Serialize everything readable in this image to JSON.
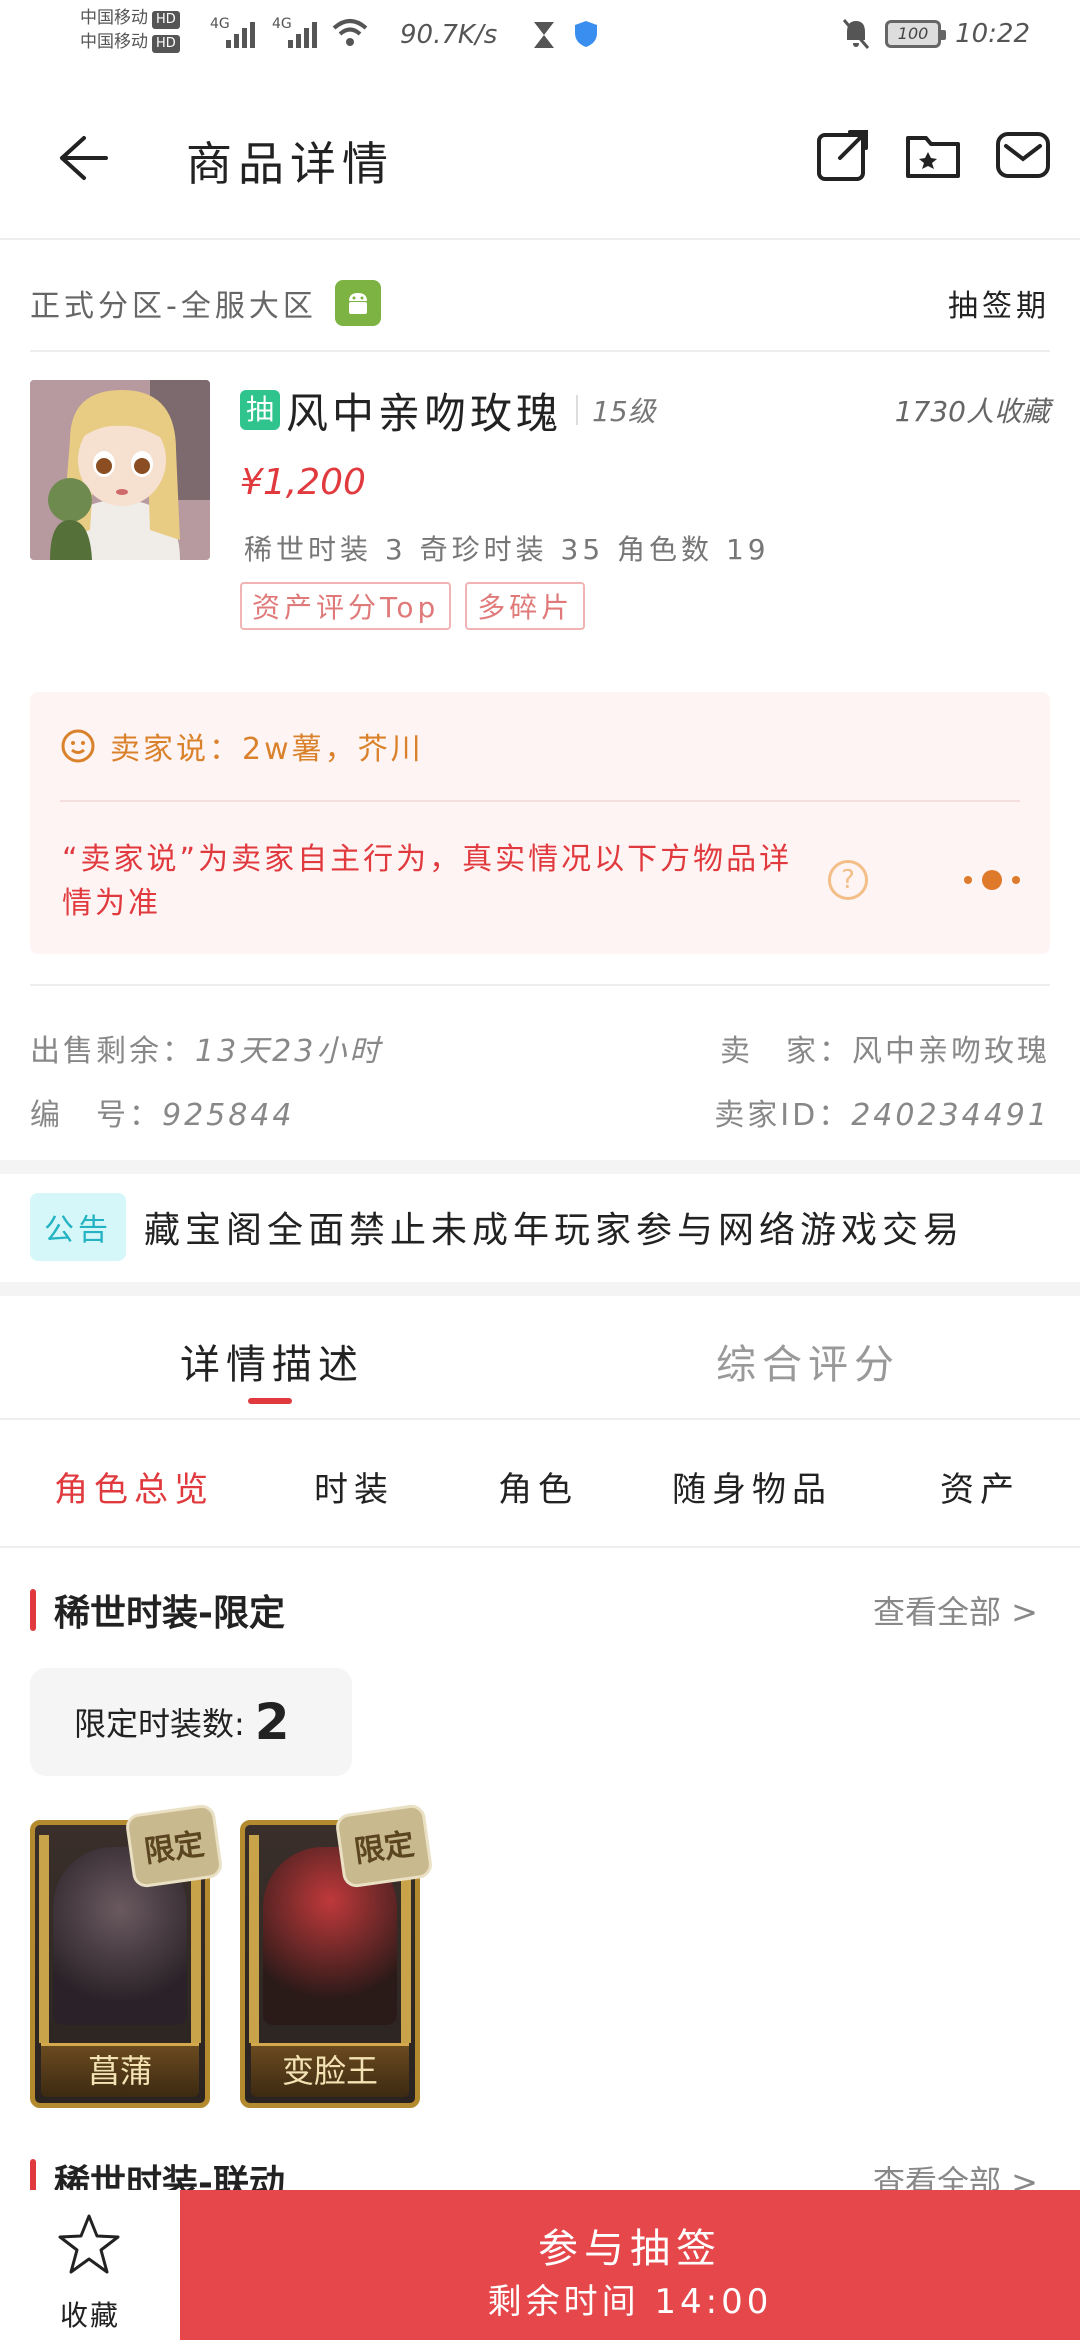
{
  "status_bar": {
    "carrier1": "中国移动",
    "carrier2": "中国移动",
    "hd": "HD",
    "net1": "4G",
    "net2": "4G",
    "speed": "90.7K/s",
    "battery": "100",
    "time": "10:22"
  },
  "header": {
    "title": "商品详情"
  },
  "zone": {
    "name": "正式分区-全服大区",
    "phase": "抽签期"
  },
  "item": {
    "badge": "抽",
    "name": "风中亲吻玫瑰",
    "level": "15级",
    "favorites": "1730人收藏",
    "price": "¥1,200",
    "stats": "稀世时装 3 奇珍时装 35 角色数 19",
    "tags": [
      "资产评分Top",
      "多碎片"
    ]
  },
  "seller_note": {
    "text": "卖家说：2w薯，芥川",
    "disclaimer": "“卖家说”为卖家自主行为，真实情况以下方物品详情为准",
    "help": "?"
  },
  "sale_info": {
    "remaining_label": "出售剩余：",
    "remaining_value": "13天23小时",
    "seller_label": "卖　家：",
    "seller_value": "风中亲吻玫瑰",
    "id_label": "编　号：",
    "id_value": "925844",
    "seller_id_label": "卖家ID：",
    "seller_id_value": "240234491"
  },
  "notice": {
    "badge": "公告",
    "text": "藏宝阁全面禁止未成年玩家参与网络游戏交易"
  },
  "main_tabs": [
    "详情描述",
    "综合评分"
  ],
  "sub_tabs": [
    "角色总览",
    "时装",
    "角色",
    "随身物品",
    "资产"
  ],
  "section1": {
    "title": "稀世时装-限定",
    "see_all": "查看全部 >",
    "count_label": "限定时装数:",
    "count_value": "2",
    "cards": [
      {
        "name": "菖蒲",
        "badge": "限定"
      },
      {
        "name": "变脸王",
        "badge": "限定"
      }
    ]
  },
  "section2": {
    "title": "稀世时装-联动",
    "see_all": "查看全部 >"
  },
  "bottom": {
    "fav_label": "收藏",
    "cta_main": "参与抽签",
    "cta_sub": "剩余时间 14:00"
  },
  "colors": {
    "accent_red": "#e03a3e",
    "cta_red": "#e5474a",
    "badge_green": "#2fc48e",
    "note_orange": "#d9822b",
    "notice_cyan": "#23b3c2"
  }
}
